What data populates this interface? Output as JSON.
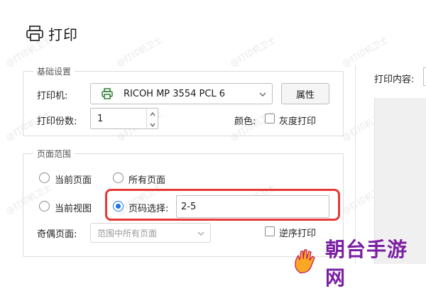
{
  "header": {
    "title": "打印",
    "icon": "printer-icon"
  },
  "basic_settings": {
    "legend": "基础设置",
    "printer_label": "打印机:",
    "printer_value": "RICOH MP 3554 PCL 6",
    "properties_button": "属性",
    "copies_label": "打印份数:",
    "copies_value": "1",
    "color_label": "颜色:",
    "grayscale_label": "灰度打印"
  },
  "page_range": {
    "legend": "页面范围",
    "current_page": "当前页面",
    "all_pages": "所有页面",
    "current_view": "当前视图",
    "page_selection_label": "页码选择:",
    "page_selection_value": "2-5",
    "odd_even_label": "奇偶页面:",
    "odd_even_value": "范围中所有页面",
    "reverse_label": "逆序打印"
  },
  "right_panel": {
    "print_content_label": "打印内容:"
  },
  "watermark_text": "@打印机卫士",
  "brand": {
    "text": "朝台手游网"
  },
  "colors": {
    "accent": "#1a73e8",
    "highlight": "#e53935",
    "brand": "#7a1fa2"
  }
}
